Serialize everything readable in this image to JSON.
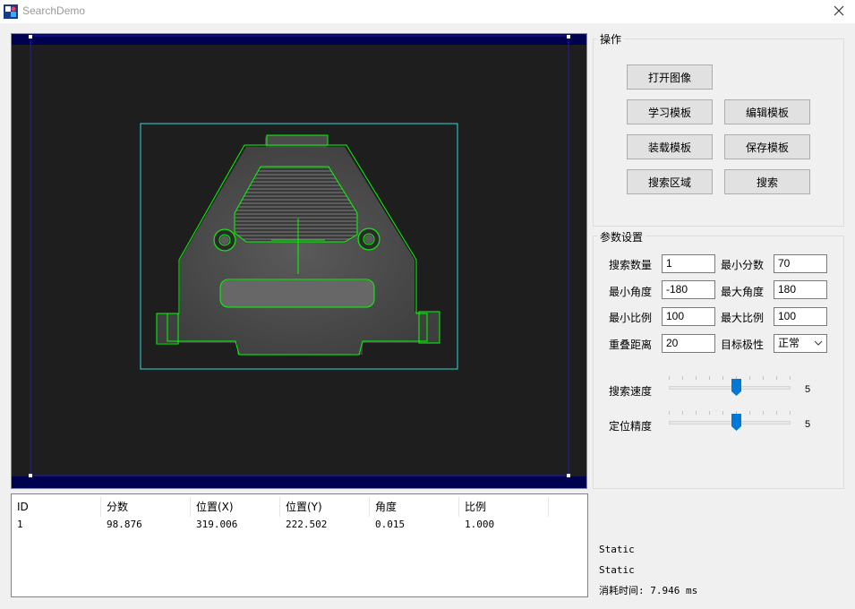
{
  "window": {
    "title": "SearchDemo",
    "icon": "app-icon",
    "close_icon": "close-icon"
  },
  "image_view": {
    "overlay_color": "#00ff00",
    "roi_color": "#2fd8d8",
    "frame_color": "#000060"
  },
  "operations": {
    "title": "操作",
    "open_image": "打开图像",
    "learn_template": "学习模板",
    "edit_template": "编辑模板",
    "load_template": "装载模板",
    "save_template": "保存模板",
    "search_region": "搜索区域",
    "search": "搜索"
  },
  "params": {
    "title": "参数设置",
    "search_count_label": "搜索数量",
    "search_count": "1",
    "min_score_label": "最小分数",
    "min_score": "70",
    "min_angle_label": "最小角度",
    "min_angle": "-180",
    "max_angle_label": "最大角度",
    "max_angle": "180",
    "min_scale_label": "最小比例",
    "min_scale": "100",
    "max_scale_label": "最大比例",
    "max_scale": "100",
    "overlap_label": "重叠距离",
    "overlap": "20",
    "polarity_label": "目标极性",
    "polarity": "正常",
    "speed_label": "搜索速度",
    "speed": "5",
    "precision_label": "定位精度",
    "precision": "5"
  },
  "results": {
    "columns": [
      "ID",
      "分数",
      "位置(X)",
      "位置(Y)",
      "角度",
      "比例"
    ],
    "rows": [
      [
        "1",
        "98.876",
        "319.006",
        "222.502",
        "0.015",
        "1.000"
      ]
    ]
  },
  "status": {
    "line1": "Static",
    "line2": "Static",
    "time_text": "消耗时间: 7.946 ms"
  },
  "colors": {
    "slider_thumb": "#0078d7",
    "background": "#f0f0f0"
  }
}
